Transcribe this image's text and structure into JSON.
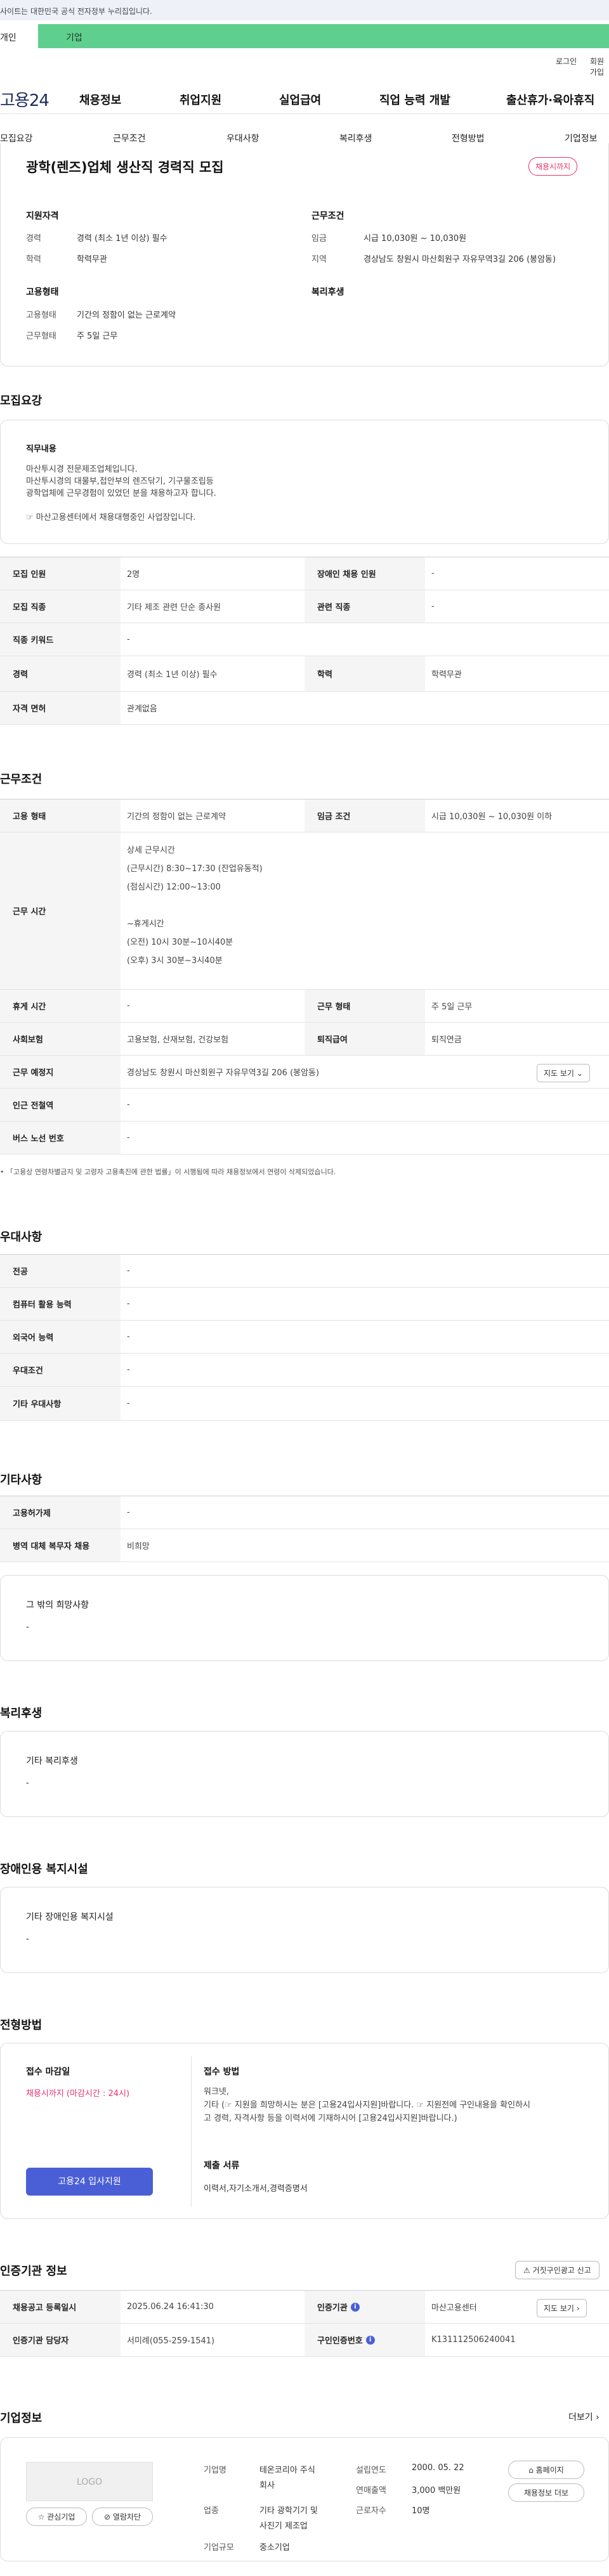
{
  "notice": {
    "text": "사이트는 대한민국 공식 전자정부 누리집입니다."
  },
  "tabs": {
    "individual": "개인",
    "business": "기업"
  },
  "util": {
    "login": "로그인",
    "join": "회원가입"
  },
  "gnb": {
    "logo": "고용24",
    "items": [
      "채용정보",
      "취업지원",
      "실업급여",
      "직업 능력 개발",
      "출산휴가·육아휴직"
    ]
  },
  "subnav": {
    "items": [
      "모집요강",
      "근무조건",
      "우대사항",
      "복리후생",
      "전형방법",
      "기업정보"
    ]
  },
  "summary": {
    "title": "광학(렌즈)업체 생산직 경력직 모집",
    "badge": "채용시까지",
    "qual_title": "지원자격",
    "career_label": "경력",
    "career_value": "경력 (최소 1년 이상) 필수",
    "edu_label": "학력",
    "edu_value": "학력무관",
    "cond_title": "근무조건",
    "wage_label": "임금",
    "wage_value": "시급 10,030원 ~ 10,030원",
    "region_label": "지역",
    "region_value": "경상남도 창원시 마산회원구 자유무역3길 206 (봉암동)",
    "emp_title": "고용형태",
    "emptype_label": "고용형태",
    "emptype_value": "기간의 정함이 없는 근로계약",
    "workform_label": "근무형태",
    "workform_value": "주 5일 근무",
    "welfare_title": "복리후생"
  },
  "recruit": {
    "section_title": "모집요강",
    "duty_title": "직무내용",
    "duty_lines": [
      "마산투시경 전문제조업체입니다.",
      "마산투시경의 대물부,접안부의 렌즈닦기, 기구물조립등",
      "광학업체에 근무경험이 있었던 분을 채용하고자 합니다."
    ],
    "duty_note": "☞ 마산고용센터에서 채용대행중인 사업장입니다.",
    "rows": [
      {
        "k1": "모집 인원",
        "v1": "2명",
        "k2": "장애인 채용 인원",
        "v2": "-"
      },
      {
        "k1": "모집 직종",
        "v1": "기타 제조 관련 단순 종사원",
        "k2": "관련 직종",
        "v2": "-"
      },
      {
        "k1": "직종 키워드",
        "v1": "-"
      },
      {
        "k1": "경력",
        "v1": "경력 (최소 1년 이상) 필수",
        "k2": "학력",
        "v2": "학력무관"
      },
      {
        "k1": "자격 면허",
        "v1": "관계없음"
      }
    ]
  },
  "work": {
    "section_title": "근무조건",
    "emp_label": "고용 형태",
    "emp_value": "기간의 정함이 없는 근로계약",
    "wage_label": "임금 조건",
    "wage_value": "시급 10,030원 ~ 10,030원 이하",
    "time_label": "근무 시간",
    "time_lines": [
      "상세 근무시간",
      "(근무시간) 8:30~17:30 (잔업유동적)",
      "(점심시간) 12:00~13:00",
      "",
      "~휴게시간",
      "(오전) 10시 30분~10시40분",
      "(오후) 3시 30분~3시40분"
    ],
    "rest_label": "휴게 시간",
    "rest_value": "-",
    "workform_label": "근무 형태",
    "workform_value": "주 5일 근무",
    "ins_label": "사회보험",
    "ins_value": "고용보험, 산재보험, 건강보험",
    "retire_label": "퇴직급여",
    "retire_value": "퇴직연금",
    "place_label": "근무 예정지",
    "place_value": "경상남도 창원시 마산회원구 자유무역3길 206 (봉암동)",
    "map_btn": "지도 보기",
    "subway_label": "인근 전철역",
    "subway_value": "-",
    "bus_label": "버스 노선 번호",
    "bus_value": "-",
    "footnote": "「고용상 연령차별금지 및 고령자 고용촉진에 관한 법률」이 시행됨에 따라 채용정보에서 연령이 삭제되었습니다."
  },
  "prefer": {
    "section_title": "우대사항",
    "rows": [
      {
        "k": "전공",
        "v": "-"
      },
      {
        "k": "컴퓨터 활용 능력",
        "v": "-"
      },
      {
        "k": "외국어 능력",
        "v": "-"
      },
      {
        "k": "우대조건",
        "v": "-"
      },
      {
        "k": "기타 우대사항",
        "v": "-"
      }
    ]
  },
  "etc": {
    "section_title": "기타사항",
    "rows": [
      {
        "k": "고용허가제",
        "v": "-"
      },
      {
        "k": "병역 대체 복무자 채용",
        "v": "비희망"
      }
    ],
    "other_title": "그 밖의 희망사항",
    "other_value": "-"
  },
  "welfare": {
    "section_title": "복리후생",
    "box_title": "기타 복리후생",
    "box_value": "-"
  },
  "disabled": {
    "section_title": "장애인용 복지시설",
    "box_title": "기타 장애인용 복지시설",
    "box_value": "-"
  },
  "selection": {
    "section_title": "전형방법",
    "deadline_title": "접수 마감일",
    "deadline_value": "채용시까지 (마감시간 : 24시)",
    "apply_button": "고용24 입사지원",
    "method_title": "접수 방법",
    "method_lines": [
      "워크넷,",
      "기타 (☞ 지원을 희망하시는 분은 [고용24입사지원]바랍니다. ☞ 지원전에 구인내용을 확인하시",
      "고 경력, 자격사항 등을 이력서에 기재하시어 [고용24입사지원]바랍니다.)"
    ],
    "docs_title": "제출 서류",
    "docs_value": "이력서,자기소개서,경력증명서"
  },
  "agency": {
    "section_title": "인증기관 정보",
    "report_btn": "거짓구인광고 신고",
    "reg_label": "채용공고 등록일시",
    "reg_value": "2025.06.24 16:41:30",
    "org_label": "인증기관",
    "org_value": "마산고용센터",
    "map_btn": "지도 보기",
    "mgr_label": "인증기관 담당자",
    "mgr_value": "서미례(055-259-1541)",
    "auth_label": "구인인증번호",
    "auth_value": "K131112506240041"
  },
  "company": {
    "section_title": "기업정보",
    "more": "더보기",
    "logo_text": "LOGO",
    "fav_btn": "관심기업",
    "block_btn": "열람차단",
    "name_label": "기업명",
    "name_value_1": "테온코리아 주식",
    "name_value_2": "회사",
    "biz_label": "업종",
    "biz_value_1": "기타 광학기기 및",
    "biz_value_2": "사진기 제조업",
    "size_label": "기업규모",
    "size_value": "중소기업",
    "founded_label": "설립연도",
    "founded_value": "2000. 05. 22",
    "sales_label": "연매출액",
    "sales_value": "3,000 백만원",
    "workers_label": "근로자수",
    "workers_value": "10명",
    "homepage_btn": "홈페이지",
    "other_jobs_btn": "채용정보 더보"
  },
  "colors": {
    "accent": "#4a5fd6",
    "badge": "#e8336b",
    "biz_tab": "#5fcf8f"
  }
}
